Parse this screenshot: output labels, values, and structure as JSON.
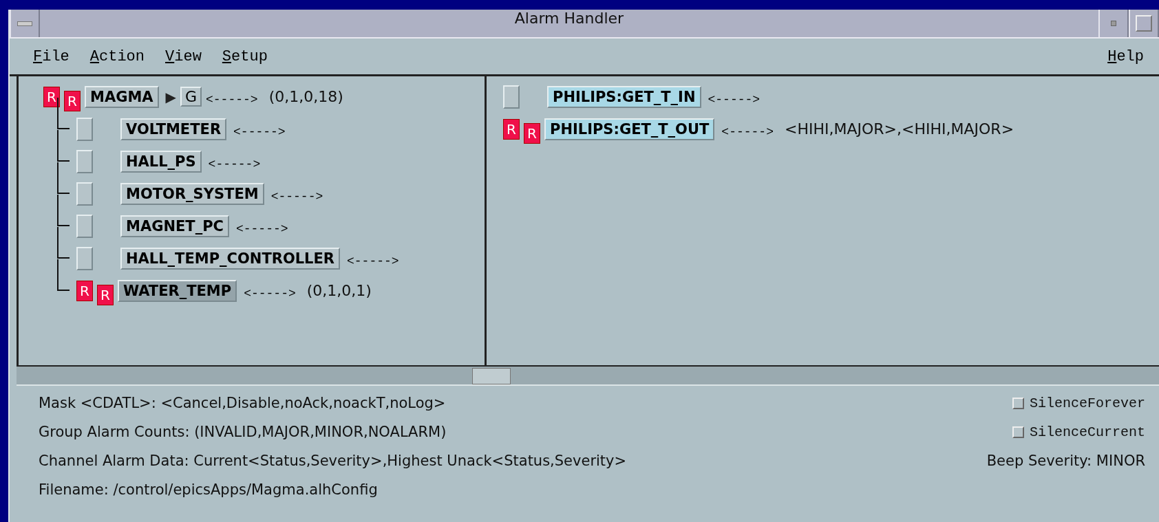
{
  "window": {
    "title": "Alarm Handler"
  },
  "menu": [
    {
      "label": "File"
    },
    {
      "label": "Action"
    },
    {
      "label": "View"
    },
    {
      "label": "Setup"
    }
  ],
  "help_menu": {
    "label": "Help"
  },
  "group": {
    "name": "MAGMA",
    "alarm": true,
    "flags": [
      "R",
      "R"
    ],
    "expand_arrow": "▶",
    "guidance": "G",
    "summary": "<----->",
    "counts": "(0,1,0,18)",
    "selected": false,
    "children": [
      {
        "name": "VOLTMETER",
        "alarm": false,
        "summary": "<----->",
        "selected": false
      },
      {
        "name": "HALL_PS",
        "alarm": false,
        "summary": "<----->",
        "selected": false
      },
      {
        "name": "MOTOR_SYSTEM",
        "alarm": false,
        "summary": "<----->",
        "selected": false
      },
      {
        "name": "MAGNET_PC",
        "alarm": false,
        "summary": "<----->",
        "selected": false
      },
      {
        "name": "HALL_TEMP_CONTROLLER",
        "alarm": false,
        "summary": "<----->",
        "selected": false
      },
      {
        "name": "WATER_TEMP",
        "alarm": true,
        "flags": [
          "R",
          "R"
        ],
        "summary": "<----->",
        "counts": "(0,1,0,1)",
        "selected": true
      }
    ]
  },
  "channels": [
    {
      "name": "PHILIPS:GET_T_IN",
      "alarm": false,
      "summary": "<----->"
    },
    {
      "name": "PHILIPS:GET_T_OUT",
      "alarm": true,
      "flags": [
        "R",
        "R"
      ],
      "summary": "<----->",
      "status": "<HIHI,MAJOR>,<HIHI,MAJOR>"
    }
  ],
  "info": {
    "lines": [
      "Mask <CDATL>: <Cancel,Disable,noAck,noackT,noLog>",
      "Group Alarm Counts: (INVALID,MAJOR,MINOR,NOALARM)",
      "Channel Alarm Data: Current<Status,Severity>,Highest Unack<Status,Severity>",
      "Filename: /control/epicsApps/Magma.alhConfig"
    ],
    "toggles": [
      {
        "label": "SilenceForever",
        "checked": false
      },
      {
        "label": "SilenceCurrent",
        "checked": false
      }
    ],
    "beep_severity": "Beep Severity:  MINOR"
  }
}
